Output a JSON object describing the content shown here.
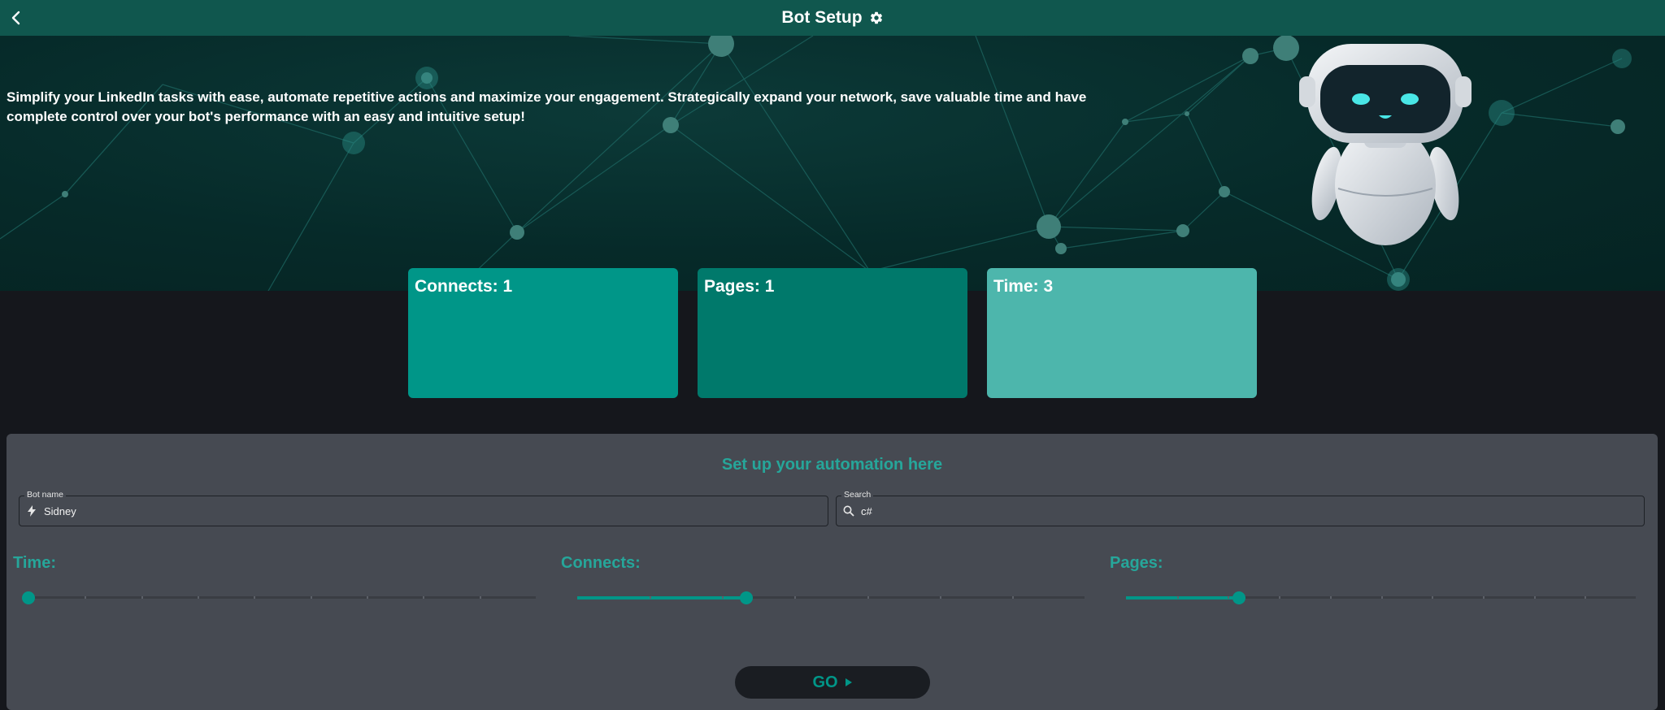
{
  "header": {
    "title": "Bot Setup",
    "back_icon": "chevron-left-icon",
    "settings_icon": "gear-icon"
  },
  "hero": {
    "description": "Simplify your LinkedIn tasks with ease, automate repetitive actions and maximize your engagement. Strategically expand your network, save valuable time and have complete control over your bot's performance with an easy and intuitive setup!"
  },
  "stats": {
    "connects": "Connects: 1",
    "pages": "Pages: 1",
    "time": "Time: 3"
  },
  "form": {
    "title": "Set up your automation here",
    "bot_name": {
      "label": "Bot name",
      "value": "Sidney",
      "icon": "lightning-bolt-icon"
    },
    "search": {
      "label": "Search",
      "value": "c#",
      "icon": "search-icon"
    }
  },
  "sliders": {
    "time": {
      "label": "Time:",
      "fraction": 0.0,
      "color": "#009688"
    },
    "connects": {
      "label": "Connects:",
      "fraction": 0.3333,
      "color": "#009688"
    },
    "pages": {
      "label": "Pages:",
      "fraction": 0.2222,
      "color": "#009688"
    }
  },
  "go_button": {
    "label": "GO",
    "icon": "play-icon"
  },
  "colors": {
    "header": "#10574e",
    "accent": "#009688",
    "panel": "#464a52",
    "stat_connects": "#009688",
    "stat_pages": "#00796b",
    "stat_time": "#4db6ac"
  }
}
